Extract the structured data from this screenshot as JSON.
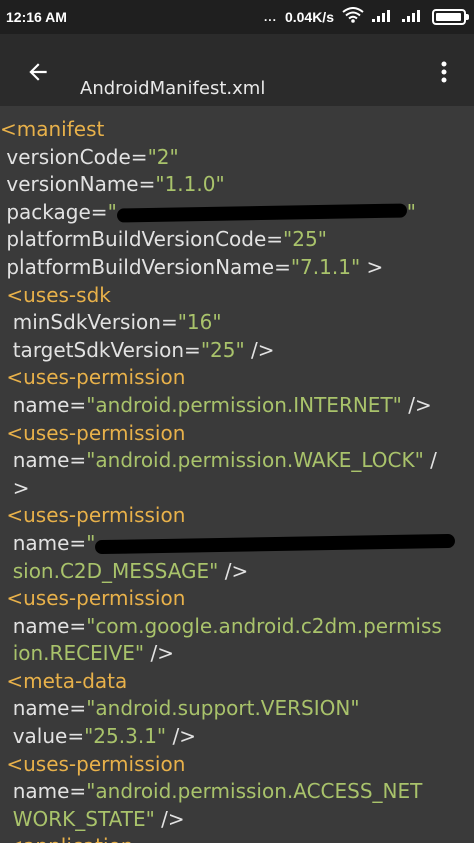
{
  "status_bar": {
    "time": "12:16 AM",
    "dots": "...",
    "net_speed": "0.04K/s",
    "wifi_icon": "wifi-icon",
    "signal_icons": [
      "signal-icon",
      "signal-icon"
    ],
    "battery_level": 0.95,
    "battery_icon": "battery-icon"
  },
  "toolbar": {
    "back_icon": "arrow-left-icon",
    "title": "AndroidManifest.xml",
    "more_icon": "more-vert-icon"
  },
  "colors": {
    "tag": "#e8b14a",
    "attribute": "#e2e2e2",
    "value": "#a9c36b",
    "background": "#3a3a3a",
    "toolbar": "#2b2b2b"
  },
  "code": {
    "lines": [
      {
        "s": [
          {
            "t": "tag",
            "v": "<manifest"
          }
        ]
      },
      {
        "s": [
          {
            "t": "attr",
            "v": " versionCode="
          },
          {
            "t": "val",
            "v": "\"2\""
          }
        ]
      },
      {
        "s": [
          {
            "t": "attr",
            "v": " versionName="
          },
          {
            "t": "val",
            "v": "\"1.1.0\""
          }
        ]
      },
      {
        "s": [
          {
            "t": "attr",
            "v": " package="
          },
          {
            "t": "val",
            "v": "\""
          },
          {
            "t": "redact",
            "v": "290"
          },
          {
            "t": "val",
            "v": "\""
          }
        ]
      },
      {
        "s": [
          {
            "t": "attr",
            "v": " platformBuildVersionCode="
          },
          {
            "t": "val",
            "v": "\"25\""
          }
        ]
      },
      {
        "s": [
          {
            "t": "attr",
            "v": " platformBuildVersionName="
          },
          {
            "t": "val",
            "v": "\"7.1.1\""
          },
          {
            "t": "plain",
            "v": " >"
          }
        ]
      },
      {
        "s": [
          {
            "t": "tag",
            "v": " <uses-sdk"
          }
        ]
      },
      {
        "s": [
          {
            "t": "attr",
            "v": "  minSdkVersion="
          },
          {
            "t": "val",
            "v": "\"16\""
          }
        ]
      },
      {
        "s": [
          {
            "t": "attr",
            "v": "  targetSdkVersion="
          },
          {
            "t": "val",
            "v": "\"25\""
          },
          {
            "t": "plain",
            "v": " />"
          }
        ]
      },
      {
        "s": [
          {
            "t": "tag",
            "v": " <uses-permission"
          }
        ]
      },
      {
        "s": [
          {
            "t": "attr",
            "v": "  name="
          },
          {
            "t": "val",
            "v": "\"android.permission.INTERNET\""
          },
          {
            "t": "plain",
            "v": " />"
          }
        ]
      },
      {
        "s": [
          {
            "t": "tag",
            "v": " <uses-permission"
          }
        ]
      },
      {
        "s": [
          {
            "t": "attr",
            "v": "  name="
          },
          {
            "t": "val",
            "v": "\"android.permission.WAKE_LOCK\""
          },
          {
            "t": "plain",
            "v": " /"
          }
        ]
      },
      {
        "s": [
          {
            "t": "plain",
            "v": "  >"
          }
        ]
      },
      {
        "s": [
          {
            "t": "tag",
            "v": " <uses-permission"
          }
        ]
      },
      {
        "s": [
          {
            "t": "attr",
            "v": "  name="
          },
          {
            "t": "val",
            "v": "\""
          },
          {
            "t": "redact",
            "v": "360"
          }
        ]
      },
      {
        "s": [
          {
            "t": "val",
            "v": "  sion.C2D_MESSAGE\""
          },
          {
            "t": "plain",
            "v": " />"
          }
        ]
      },
      {
        "s": [
          {
            "t": "tag",
            "v": " <uses-permission"
          }
        ]
      },
      {
        "s": [
          {
            "t": "attr",
            "v": "  name="
          },
          {
            "t": "val",
            "v": "\"com.google.android.c2dm.permiss"
          }
        ]
      },
      {
        "s": [
          {
            "t": "val",
            "v": "  ion.RECEIVE\""
          },
          {
            "t": "plain",
            "v": " />"
          }
        ]
      },
      {
        "s": [
          {
            "t": "tag",
            "v": " <meta-data"
          }
        ]
      },
      {
        "s": [
          {
            "t": "attr",
            "v": "  name="
          },
          {
            "t": "val",
            "v": "\"android.support.VERSION\""
          }
        ]
      },
      {
        "s": [
          {
            "t": "attr",
            "v": "  value="
          },
          {
            "t": "val",
            "v": "\"25.3.1\""
          },
          {
            "t": "plain",
            "v": " />"
          }
        ]
      },
      {
        "s": [
          {
            "t": "tag",
            "v": " <uses-permission"
          }
        ]
      },
      {
        "s": [
          {
            "t": "attr",
            "v": "  name="
          },
          {
            "t": "val",
            "v": "\"android.permission.ACCESS_NET"
          }
        ]
      },
      {
        "s": [
          {
            "t": "val",
            "v": "  WORK_STATE\""
          },
          {
            "t": "plain",
            "v": " />"
          }
        ]
      },
      {
        "s": [
          {
            "t": "tag",
            "v": " <application"
          }
        ]
      }
    ]
  }
}
